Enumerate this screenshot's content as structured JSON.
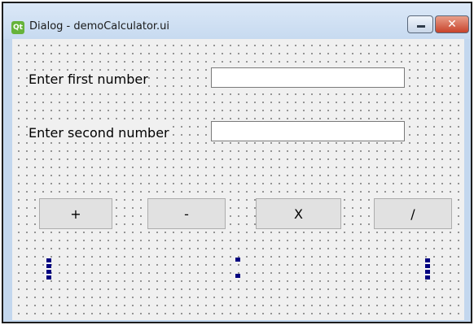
{
  "window": {
    "title": "Dialog - demoCalculator.ui",
    "app_icon_text": "Qt",
    "minimize_glyph": "",
    "close_glyph": "✕"
  },
  "form": {
    "first_number_label": "Enter first number",
    "second_number_label": "Enter second number",
    "first_number_value": "",
    "second_number_value": ""
  },
  "buttons": {
    "add": "+",
    "subtract": "-",
    "multiply": "X",
    "divide": "/"
  },
  "colors": {
    "title_bar": "#c7daf0",
    "form_background": "#f0f0f0",
    "button_face": "#e1e1e1",
    "resize_handle": "#000080",
    "close_button": "#c8432b"
  },
  "icons": {
    "app": "qt-logo-icon",
    "minimize": "minimize-icon",
    "close": "close-icon",
    "handles": "resize-handle-icon"
  }
}
